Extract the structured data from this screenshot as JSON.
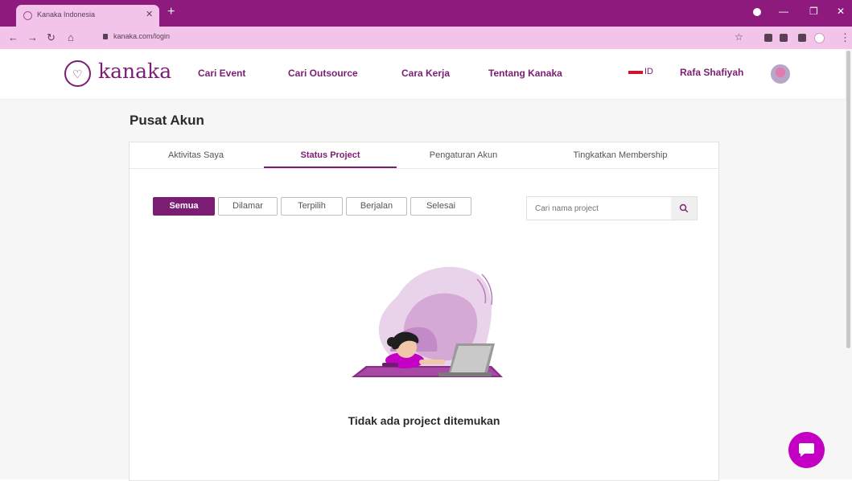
{
  "browser": {
    "tab_title": "Kanaka Indonesia",
    "url": "kanaka.com/login"
  },
  "header": {
    "logo_text": "kanaka",
    "nav": [
      "Cari Event",
      "Cari Outsource",
      "Cara Kerja",
      "Tentang Kanaka"
    ],
    "language": "ID",
    "username": "Rafa Shafiyah"
  },
  "page": {
    "title": "Pusat Akun",
    "tabs": [
      "Aktivitas Saya",
      "Status Project",
      "Pengaturan Akun",
      "Tingkatkan Membership"
    ],
    "active_tab": "Status Project",
    "filters": [
      "Semua",
      "Dilamar",
      "Terpilih",
      "Berjalan",
      "Selesai"
    ],
    "active_filter": "Semua",
    "search_placeholder": "Cari nama project",
    "empty_message": "Tidak ada project ditemukan"
  },
  "colors": {
    "brand": "#7b1d73",
    "chrome": "#8f1a7e",
    "chrome_light": "#f3c4e9",
    "fab": "#c400c4"
  },
  "icons": [
    "search-icon",
    "chat-icon",
    "back-icon",
    "forward-icon",
    "reload-icon",
    "home-icon",
    "lock-icon",
    "star-icon"
  ]
}
